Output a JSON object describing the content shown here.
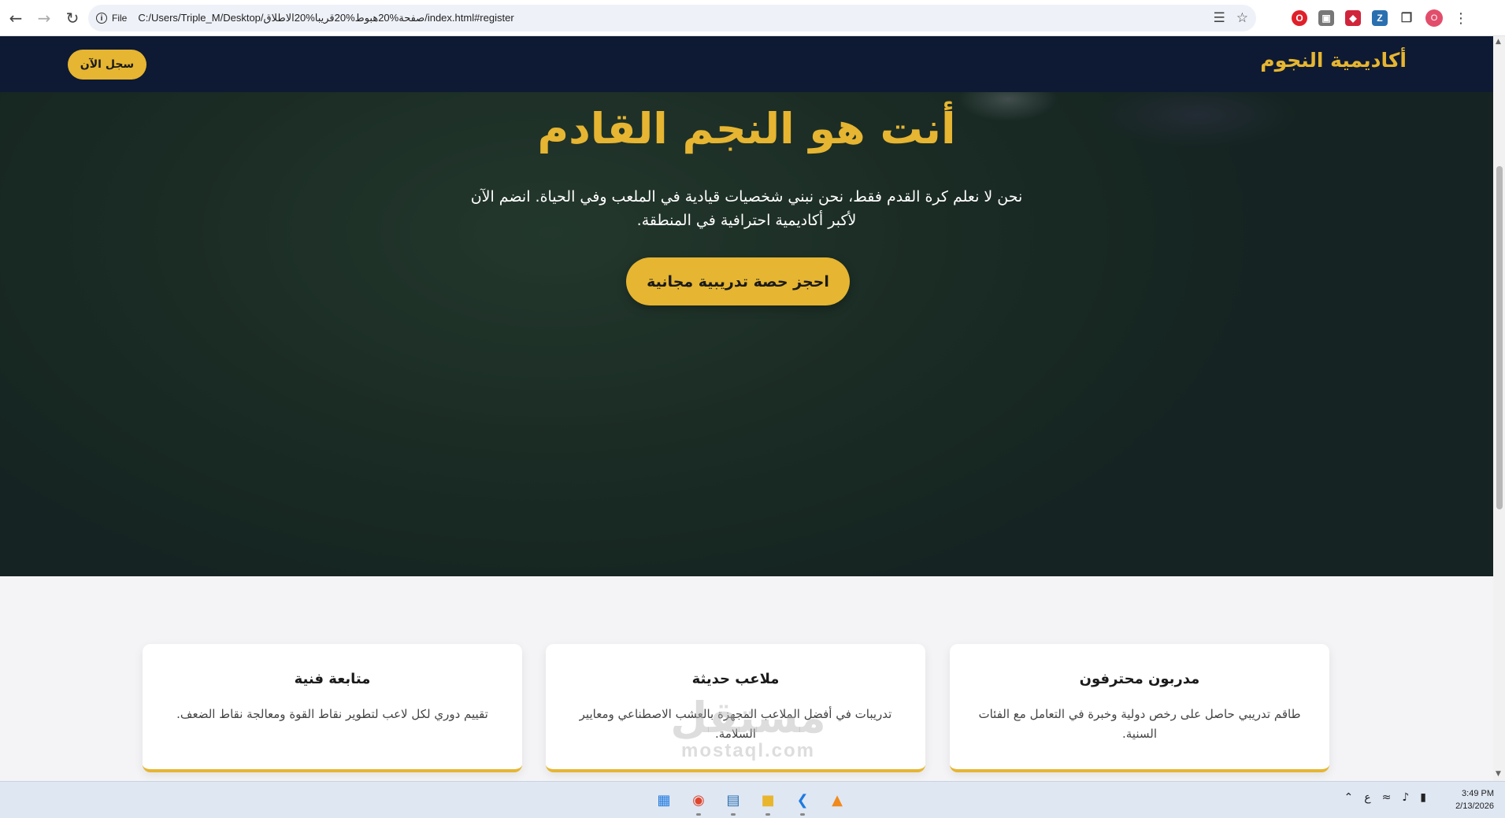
{
  "browser": {
    "site_label": "File",
    "url": "C:/Users/Triple_M/Desktop/صفحة%20هبوط%20قريبا%20الاطلاق/index.html#register",
    "profile_initial": "O"
  },
  "site": {
    "brand": "أكاديمية النجوم",
    "nav_cta": "سجل الآن"
  },
  "hero": {
    "title": "أنت هو النجم القادم",
    "subtitle": "نحن لا نعلم كرة القدم فقط، نحن نبني شخصيات قيادية في الملعب وفي الحياة. انضم الآن لأكبر أكاديمية احترافية في المنطقة.",
    "cta": "احجز حصة تدريبية مجانية"
  },
  "features": [
    {
      "title": "مدربون محترفون",
      "text": "طاقم تدريبي حاصل على رخص دولية وخبرة في التعامل مع الفئات السنية."
    },
    {
      "title": "ملاعب حديثة",
      "text": "تدريبات في أفضل الملاعب المجهزة بالعشب الاصطناعي ومعايير السلامة."
    },
    {
      "title": "متابعة فنية",
      "text": "تقييم دوري لكل لاعب لتطوير نقاط القوة ومعالجة نقاط الضعف."
    }
  ],
  "watermark": {
    "arabic": "مستقل",
    "latin": "mostaql.com"
  },
  "taskbar": {
    "input_indicator": "ع",
    "time": "3:49 PM",
    "date": "2/13/2026"
  },
  "colors": {
    "accent": "#e6b531",
    "navbar": "#0e1a33"
  }
}
